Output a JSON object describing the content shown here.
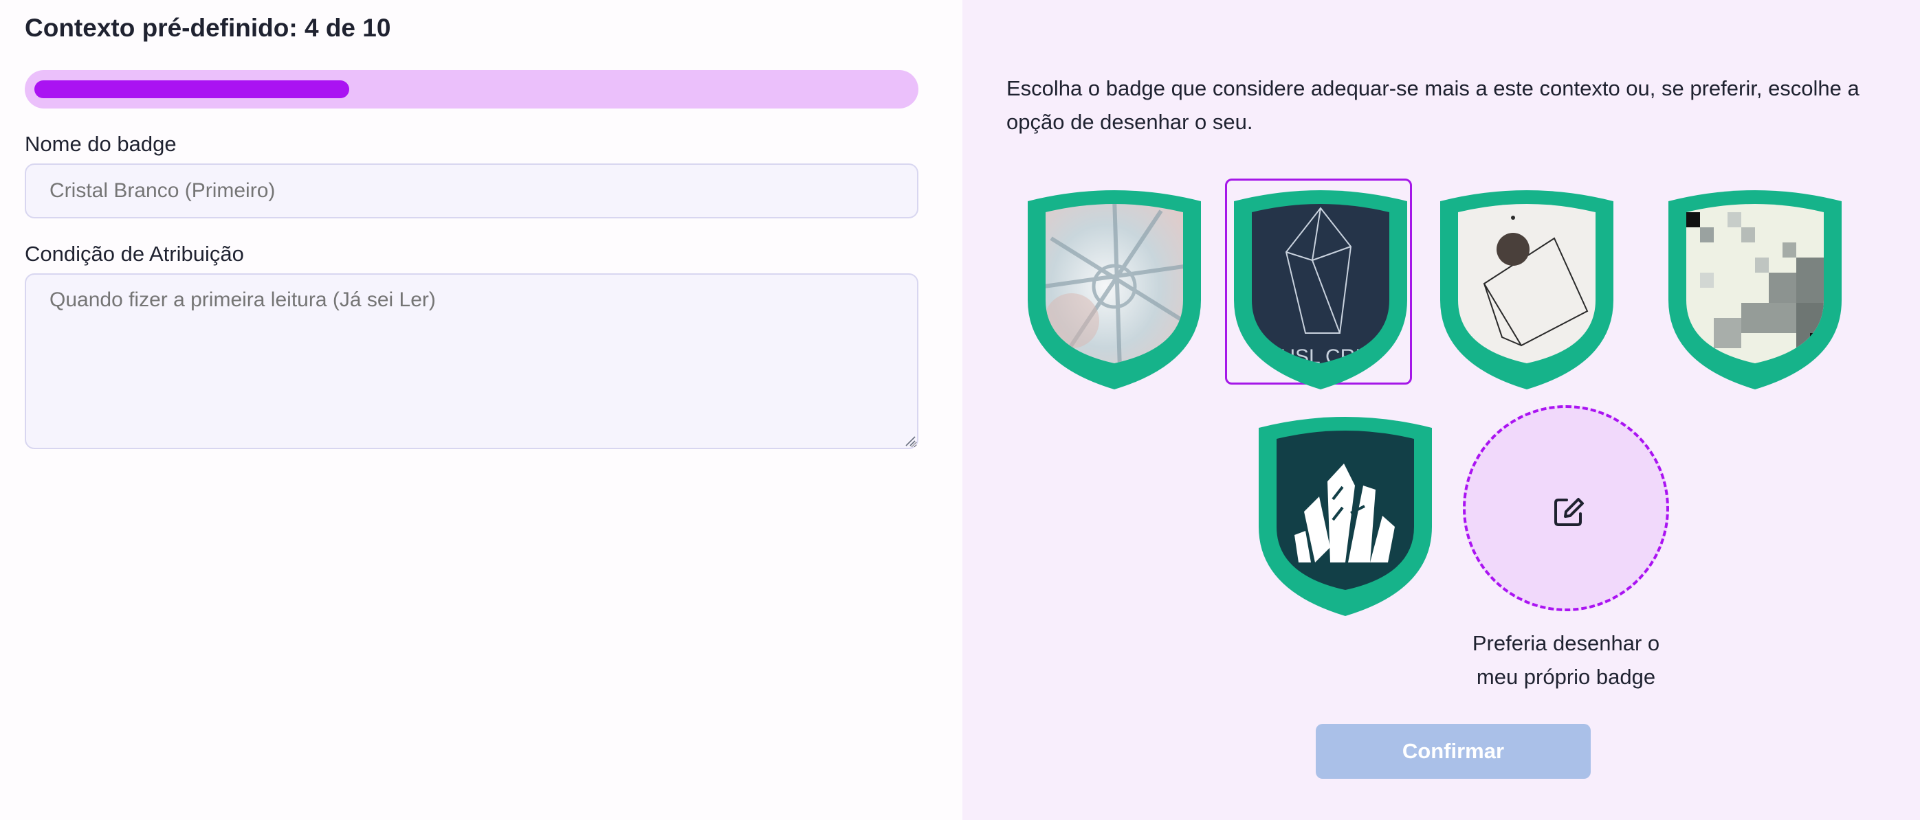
{
  "header": {
    "title": "Contexto pré-definido: 4 de 10",
    "progress_percent": 36
  },
  "form": {
    "name_label": "Nome do badge",
    "name_placeholder": "Cristal Branco (Primeiro)",
    "condition_label": "Condição de Atribuição",
    "condition_placeholder": "Quando fizer a primeira leitura (Já sei Ler)"
  },
  "badges": {
    "instructions": "Escolha o badge que considere adequar-se mais a este contexto ou, se preferir, escolhe a opção de desenhar o seu.",
    "selected_index": 1,
    "items": [
      {
        "name": "crystal-ball-photo-badge"
      },
      {
        "name": "line-crystal-badge",
        "caption": "PUSL CRIS"
      },
      {
        "name": "geometric-shape-badge"
      },
      {
        "name": "pixelated-crystal-badge"
      },
      {
        "name": "white-crystal-cluster-badge"
      }
    ],
    "draw_option": {
      "label": "Preferia desenhar o meu próprio badge",
      "icon": "pencil-square-icon"
    },
    "confirm_label": "Confirmar"
  },
  "colors": {
    "accent": "#aa13f2",
    "badge_green": "#16b38a",
    "confirm_disabled": "#aac0e8"
  }
}
